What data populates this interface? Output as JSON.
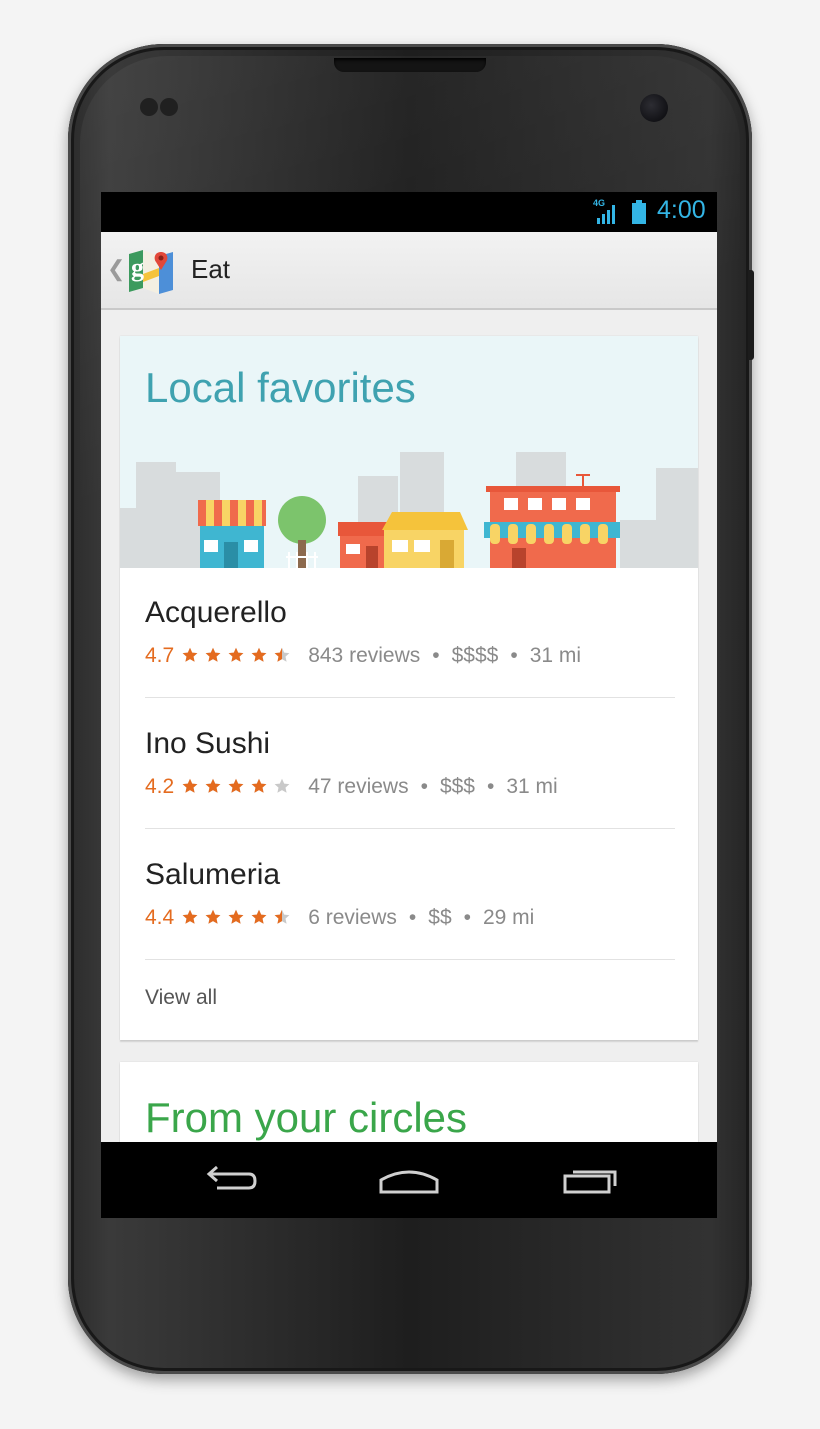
{
  "status_bar": {
    "network": "4G",
    "time": "4:00",
    "accent": "#33b5e5"
  },
  "action_bar": {
    "title": "Eat",
    "app_icon": "google-maps-icon",
    "up_icon": "up-caret-icon"
  },
  "local_favorites": {
    "title": "Local favorites",
    "title_color": "#3fa2b0",
    "rating_color": "#e46b1f",
    "places": [
      {
        "name": "Acquerello",
        "rating": "4.7",
        "stars": 4.5,
        "reviews": "843 reviews",
        "price": "$$$$",
        "distance": "31 mi"
      },
      {
        "name": "Ino Sushi",
        "rating": "4.2",
        "stars": 4,
        "reviews": "47 reviews",
        "price": "$$$",
        "distance": "31 mi"
      },
      {
        "name": "Salumeria",
        "rating": "4.4",
        "stars": 4.5,
        "reviews": "6 reviews",
        "price": "$$",
        "distance": "29 mi"
      }
    ],
    "separator": "•",
    "view_all": "View all"
  },
  "from_circles": {
    "title": "From your circles",
    "title_color": "#3aa64a"
  },
  "nav_bar": {
    "back_icon": "back-icon",
    "home_icon": "home-icon",
    "recents_icon": "recent-apps-icon"
  }
}
